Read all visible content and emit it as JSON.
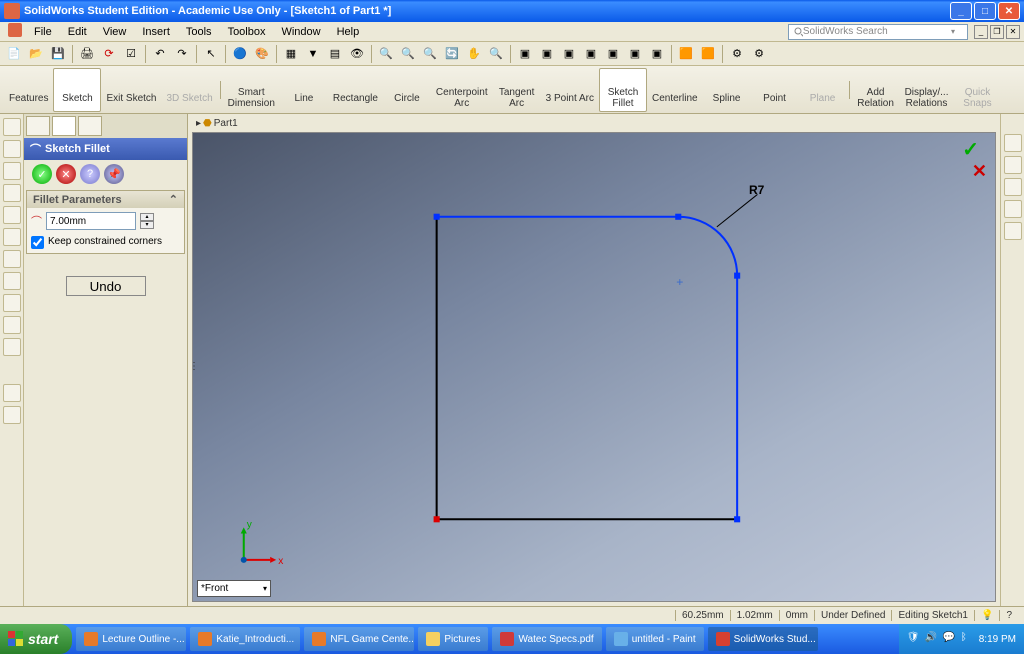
{
  "title": "SolidWorks Student Edition - Academic Use Only - [Sketch1 of Part1 *]",
  "menu": [
    "File",
    "Edit",
    "View",
    "Insert",
    "Tools",
    "Toolbox",
    "Window",
    "Help"
  ],
  "search_placeholder": "SolidWorks Search",
  "ribbon": [
    {
      "label": "Features",
      "dim": false
    },
    {
      "label": "Sketch",
      "dim": false,
      "active": true
    },
    {
      "label": "Exit Sketch",
      "dim": false
    },
    {
      "label": "3D Sketch",
      "dim": true
    },
    {
      "label": "Smart\nDimension",
      "dim": false
    },
    {
      "label": "Line",
      "dim": false
    },
    {
      "label": "Rectangle",
      "dim": false
    },
    {
      "label": "Circle",
      "dim": false
    },
    {
      "label": "Centerpoint\nArc",
      "dim": false
    },
    {
      "label": "Tangent\nArc",
      "dim": false
    },
    {
      "label": "3 Point Arc",
      "dim": false
    },
    {
      "label": "Sketch\nFillet",
      "dim": false,
      "active": true
    },
    {
      "label": "Centerline",
      "dim": false
    },
    {
      "label": "Spline",
      "dim": false
    },
    {
      "label": "Point",
      "dim": false
    },
    {
      "label": "Plane",
      "dim": true
    },
    {
      "label": "Add\nRelation",
      "dim": false
    },
    {
      "label": "Display/...\nRelations",
      "dim": false
    },
    {
      "label": "Quick\nSnaps",
      "dim": true
    }
  ],
  "doc_path": "Part1",
  "pm": {
    "title": "Sketch Fillet",
    "section": "Fillet Parameters",
    "radius": "7.00mm",
    "keep_constrained": "Keep constrained corners",
    "undo": "Undo"
  },
  "dimension_label": "R7",
  "axes": {
    "x": "x",
    "y": "y"
  },
  "view_selector": "*Front",
  "status": {
    "dist": "60.25mm",
    "delta": "1.02mm",
    "off": "0mm",
    "state": "Under Defined",
    "mode": "Editing Sketch1"
  },
  "taskbar": {
    "start": "start",
    "items": [
      {
        "label": "Lecture Outline -...",
        "cls": "ff"
      },
      {
        "label": "Katie_Introducti...",
        "cls": "ff"
      },
      {
        "label": "NFL Game Cente...",
        "cls": "ff"
      },
      {
        "label": "Pictures",
        "cls": "fold"
      },
      {
        "label": "Watec Specs.pdf",
        "cls": "pdf"
      },
      {
        "label": "untitled - Paint",
        "cls": "paint"
      },
      {
        "label": "SolidWorks Stud...",
        "cls": "sw",
        "active": true
      }
    ],
    "time": "8:19 PM"
  }
}
